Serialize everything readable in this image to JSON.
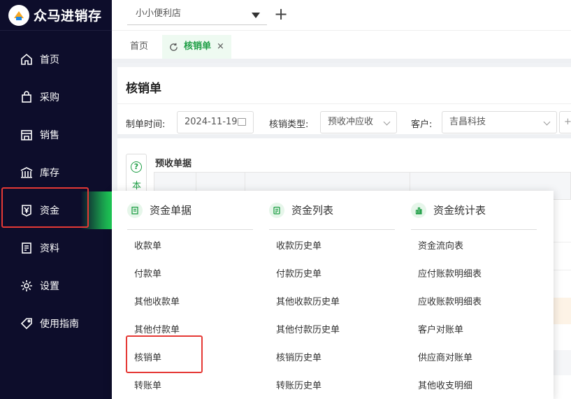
{
  "app": {
    "logo_text": "众马进销存"
  },
  "sidebar": {
    "items": [
      {
        "label": "首页",
        "icon": "home-icon"
      },
      {
        "label": "采购",
        "icon": "shopping-bag-icon"
      },
      {
        "label": "销售",
        "icon": "store-icon"
      },
      {
        "label": "库存",
        "icon": "warehouse-icon"
      },
      {
        "label": "资金",
        "icon": "yen-icon"
      },
      {
        "label": "资料",
        "icon": "document-icon"
      },
      {
        "label": "设置",
        "icon": "gear-icon"
      },
      {
        "label": "使用指南",
        "icon": "tag-icon"
      }
    ],
    "active": "资金"
  },
  "topbar": {
    "store": "小小便利店",
    "add_label": "+"
  },
  "tabs": {
    "home": "首页",
    "active": "核销单",
    "close": "×"
  },
  "page": {
    "title": "核销单",
    "filters": {
      "date_label": "制单时间:",
      "date_value": "2024-11-19",
      "type_label": "核销类型:",
      "type_value": "预收冲应收",
      "customer_label": "客户:",
      "customer_value": "吉昌科技"
    },
    "help_text": "本",
    "section_title": "预收单据"
  },
  "menu": {
    "columns": [
      {
        "title": "资金单据",
        "items": [
          "收款单",
          "付款单",
          "其他收款单",
          "其他付款单",
          "核销单",
          "转账单"
        ]
      },
      {
        "title": "资金列表",
        "items": [
          "收款历史单",
          "付款历史单",
          "其他收款历史单",
          "其他付款历史单",
          "核销历史单",
          "转账历史单"
        ]
      },
      {
        "title": "资金统计表",
        "items": [
          "资金流向表",
          "应付账款明细表",
          "应收账款明细表",
          "客户对账单",
          "供应商对账单",
          "其他收支明细"
        ]
      }
    ]
  },
  "colors": {
    "sidebar_bg": "#0d0d2b",
    "accent_green": "#1e9e45",
    "highlight_red": "#e53935"
  }
}
